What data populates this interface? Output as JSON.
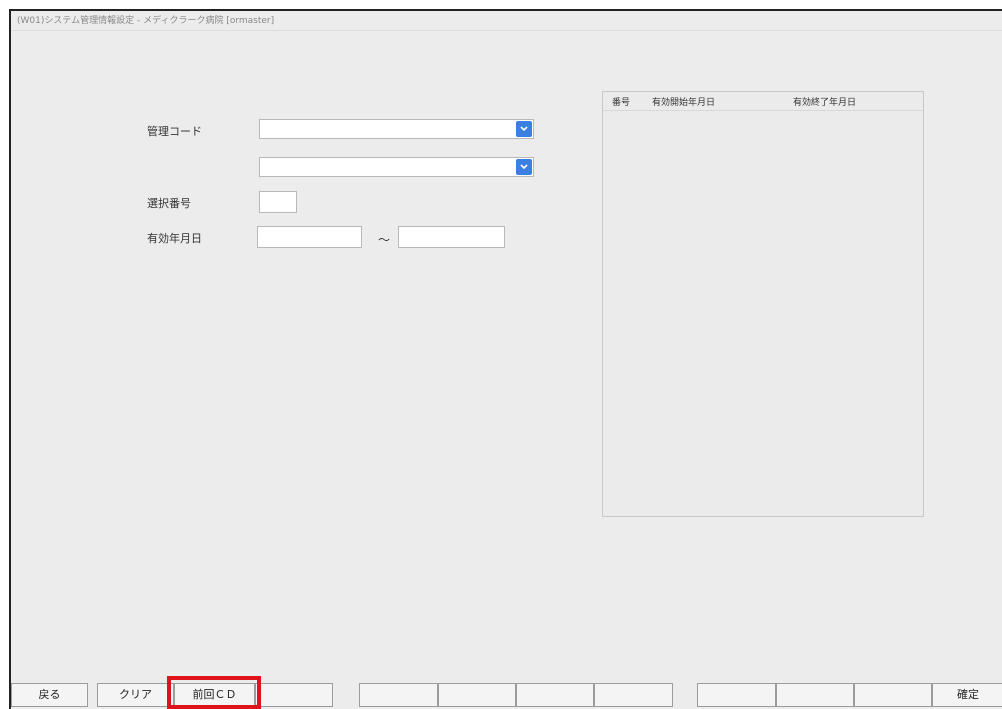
{
  "window": {
    "title": "(W01)システム管理情報設定 - メディクラーク病院 [ormaster]"
  },
  "form": {
    "kanri_code_label": "管理コード",
    "kanri_code_value": "",
    "sub_code_value": "",
    "sentaku_label": "選択番号",
    "sentaku_value": "",
    "yuko_label": "有効年月日",
    "yuko_from_value": "",
    "yuko_to_value": "",
    "tilde": "～"
  },
  "list": {
    "columns": [
      "番号",
      "有効開始年月日",
      "有効終了年月日"
    ],
    "rows": []
  },
  "fkeys": [
    {
      "label": "戻る"
    },
    {
      "label": "クリア"
    },
    {
      "label": "前回ＣＤ"
    },
    {
      "label": ""
    },
    {
      "label": ""
    },
    {
      "label": ""
    },
    {
      "label": ""
    },
    {
      "label": ""
    },
    {
      "label": ""
    },
    {
      "label": ""
    },
    {
      "label": ""
    },
    {
      "label": "確定"
    }
  ],
  "colors": {
    "highlight": "#e0131a",
    "dropdown_accent": "#3b7fe0"
  },
  "icons": {
    "dropdown": "chevron-down-icon"
  }
}
